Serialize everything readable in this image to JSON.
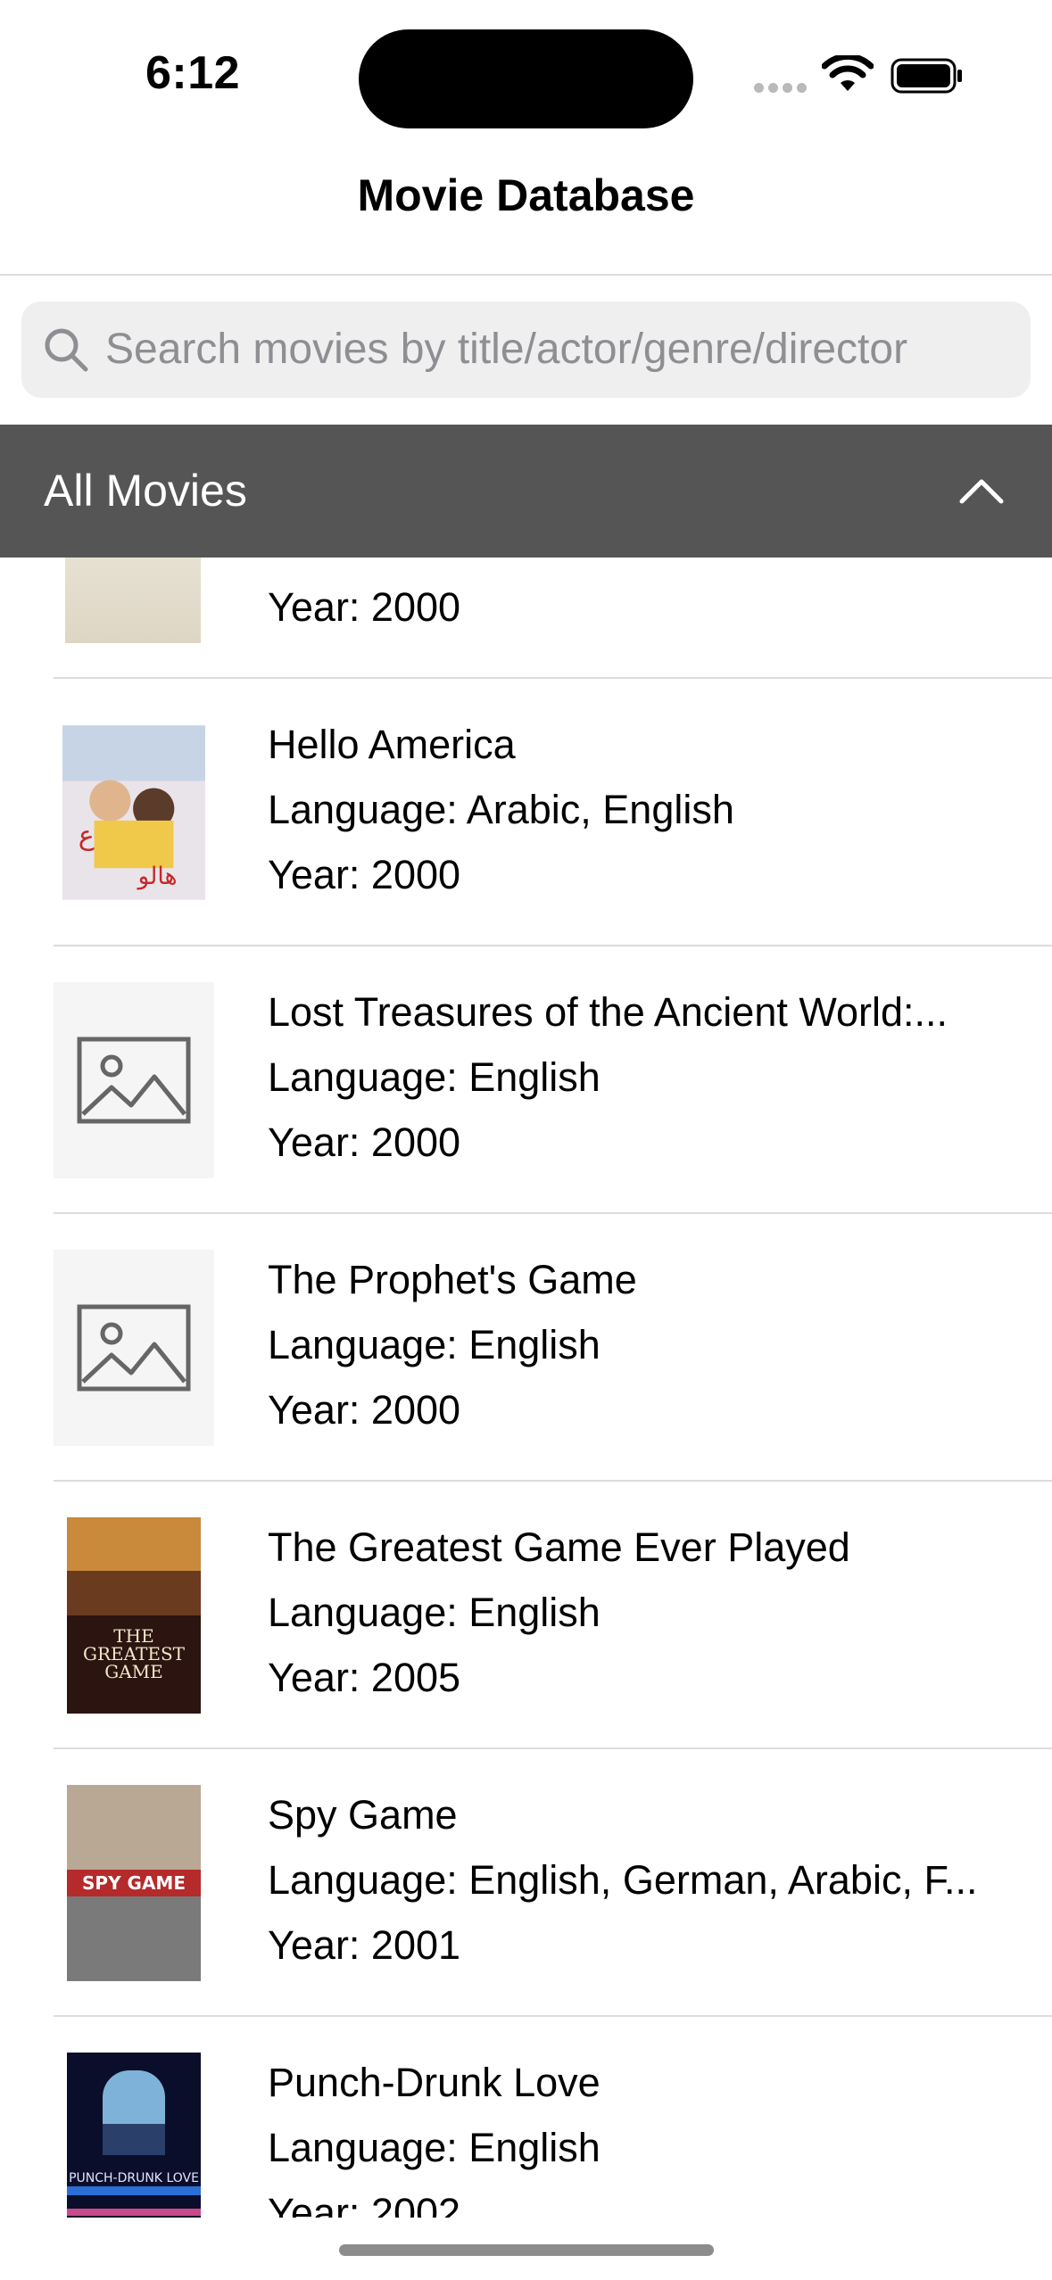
{
  "status_bar": {
    "time": "6:12"
  },
  "nav": {
    "title": "Movie Database"
  },
  "search": {
    "placeholder": "Search movies by title/actor/genre/director"
  },
  "section": {
    "title": "All Movies",
    "chevron": "chevron-up-icon"
  },
  "movies": [
    {
      "title": "",
      "language": "",
      "year": "Year: 2000",
      "poster": "partial-poster"
    },
    {
      "title": "Hello America",
      "language": "Language: Arabic, English",
      "year": "Year: 2000",
      "poster": "hello-america-poster"
    },
    {
      "title": "Lost Treasures of the Ancient World:...",
      "language": "Language: English",
      "year": "Year: 2000",
      "poster": "image-placeholder-icon"
    },
    {
      "title": "The Prophet's Game",
      "language": "Language: English",
      "year": "Year: 2000",
      "poster": "image-placeholder-icon"
    },
    {
      "title": "The Greatest Game Ever Played",
      "language": "Language: English",
      "year": "Year: 2005",
      "poster": "greatest-game-poster"
    },
    {
      "title": "Spy Game",
      "language": "Language: English, German, Arabic, F...",
      "year": "Year: 2001",
      "poster": "spy-game-poster"
    },
    {
      "title": "Punch-Drunk Love",
      "language": "Language: English",
      "year": "Year: 2002",
      "poster": "punch-drunk-love-poster"
    }
  ],
  "colors": {
    "header_bg": "#555555",
    "search_bg": "#efeff0",
    "placeholder_text": "#8e8e93"
  }
}
